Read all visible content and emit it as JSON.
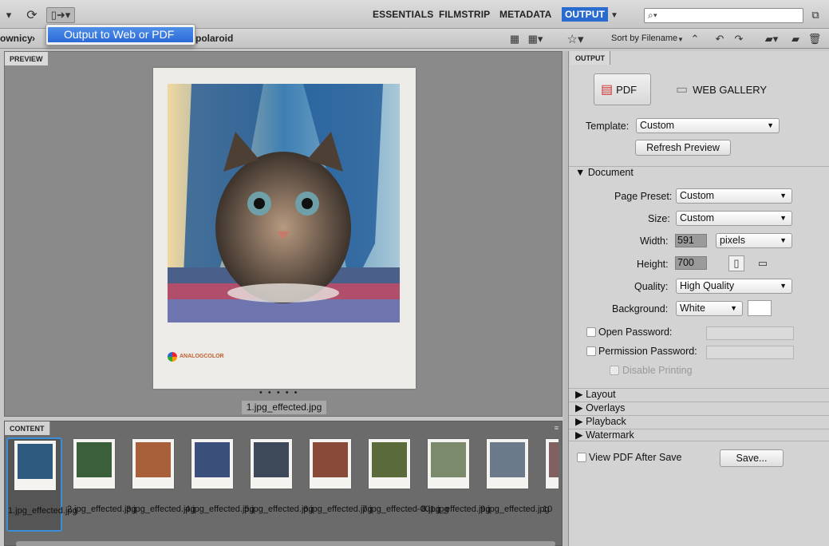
{
  "toolbar": {
    "workspaces": [
      "ESSENTIALS",
      "FILMSTRIP",
      "METADATA",
      "OUTPUT"
    ],
    "search_placeholder": "⌕▾"
  },
  "path_bar": {
    "crumb_left": "ownicy",
    "crumb_right": "polaroid",
    "sort_label": "Sort by Filename"
  },
  "popup": {
    "item": "Output to Web or PDF"
  },
  "preview": {
    "tab": "PREVIEW",
    "watermark": "ANALOGCOLOR",
    "dots": "• • • • •",
    "filename": "1.jpg_effected.jpg"
  },
  "content": {
    "tab": "CONTENT",
    "thumbs": [
      "1.jpg_effected.jpg",
      "2.jpg_effected.jpg",
      "3.jpg_effected.jpg",
      "4.jpg_effected.jpg",
      "5.jpg_effected.jpg",
      "6.jpg_effected.jpg",
      "7.jpg_effected-001.jpg",
      "8.jpg_effected.jpg",
      "9.jpg_effected.jpg",
      "10"
    ],
    "thumb_colors": [
      "#2e5a80",
      "#3b5f3a",
      "#a8603a",
      "#3a4f7a",
      "#3e4a5a",
      "#8a4a3a",
      "#5a6a3a",
      "#7a8a6a",
      "#6a7a8a",
      "#806060"
    ]
  },
  "output": {
    "tab": "OUTPUT",
    "pdf_label": "PDF",
    "web_gallery_label": "WEB GALLERY",
    "template_label": "Template:",
    "template_value": "Custom",
    "refresh_label": "Refresh Preview",
    "document_label": "▼ Document",
    "page_preset_label": "Page Preset:",
    "page_preset_value": "Custom",
    "size_label": "Size:",
    "size_value": "Custom",
    "width_label": "Width:",
    "width_value": "591",
    "units_value": "pixels",
    "height_label": "Height:",
    "height_value": "700",
    "quality_label": "Quality:",
    "quality_value": "High Quality",
    "background_label": "Background:",
    "background_value": "White",
    "open_password_label": "Open Password:",
    "permission_password_label": "Permission Password:",
    "disable_printing_label": "Disable Printing",
    "layout_label": "▶ Layout",
    "overlays_label": "▶ Overlays",
    "playback_label": "▶ Playback",
    "watermark_label": "▶ Watermark",
    "view_pdf_label": "View PDF After Save",
    "save_label": "Save..."
  }
}
